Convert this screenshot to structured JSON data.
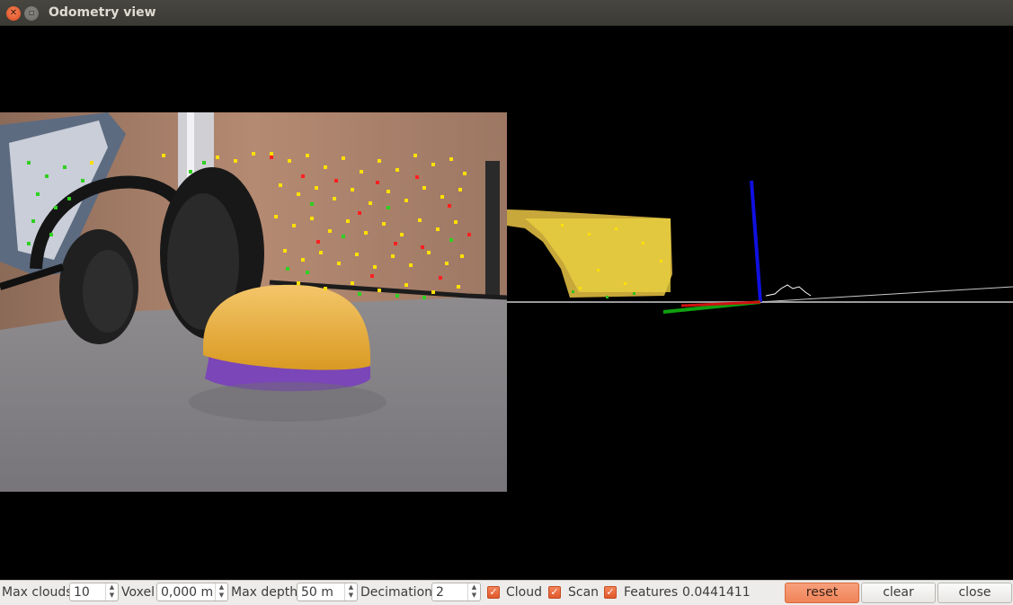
{
  "window": {
    "title": "Odometry view",
    "close_icon": "close-icon",
    "minimize_icon": "minimize-icon"
  },
  "toolbar": {
    "max_clouds": {
      "label": "Max clouds",
      "value": "10"
    },
    "voxel": {
      "label": "Voxel",
      "value": "0,000 m"
    },
    "max_depth": {
      "label": "Max depth",
      "value": "50 m"
    },
    "decimation": {
      "label": "Decimation",
      "value": "2"
    },
    "cloud": {
      "label": "Cloud",
      "checked": true
    },
    "scan": {
      "label": "Scan",
      "checked": true
    },
    "features": {
      "label": "Features",
      "checked": true
    },
    "quality_value": "0.0441411",
    "reset_label": "reset",
    "clear_label": "clear",
    "close_label": "close"
  },
  "colors": {
    "accent": "#f08458",
    "feature_inlier": "#ffe000",
    "feature_outlier": "#ff2020",
    "feature_matched": "#30d020",
    "axis_x": "#d01010",
    "axis_y": "#10a010",
    "axis_z": "#1010e0"
  }
}
